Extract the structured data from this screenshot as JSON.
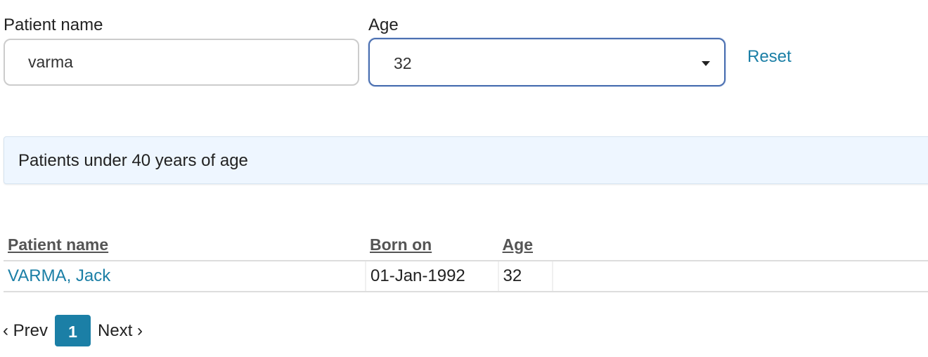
{
  "filters": {
    "name_label": "Patient name",
    "name_value": "varma",
    "age_label": "Age",
    "age_selected": "32",
    "reset_label": "Reset"
  },
  "info": {
    "message": "Patients under 40 years of age"
  },
  "table": {
    "headers": [
      "Patient name",
      "Born on",
      "Age"
    ],
    "rows": [
      [
        "VARMA, Jack",
        "01-Jan-1992",
        "32"
      ]
    ]
  },
  "pagination": {
    "prev_label": "‹ Prev",
    "current_page": "1",
    "next_label": "Next ›"
  },
  "colors": {
    "link": "#1b7fa6",
    "accent": "#1b7fa6",
    "info_background": "#eef6ff",
    "select_border": "#4a6fb0"
  }
}
